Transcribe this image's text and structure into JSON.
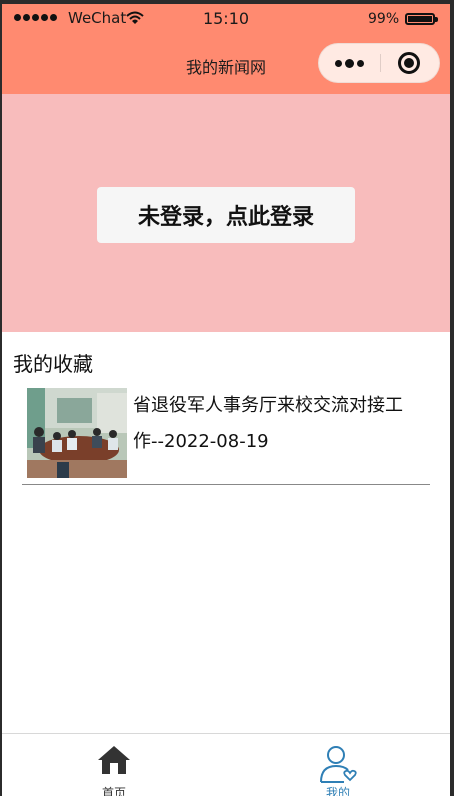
{
  "status_bar": {
    "carrier": "WeChat",
    "time": "15:10",
    "battery_percent": "99%"
  },
  "navbar": {
    "title": "我的新闻网"
  },
  "banner": {
    "login_label": "未登录，点此登录"
  },
  "favorites": {
    "heading": "我的收藏",
    "items": [
      {
        "title": "省退役军人事务厅来校交流对接工作--2022-08-19"
      }
    ]
  },
  "tabbar": {
    "tabs": [
      {
        "label": "首页",
        "icon": "home-icon"
      },
      {
        "label": "我的",
        "icon": "user-icon"
      }
    ],
    "active_color": "#2f7fb5"
  },
  "colors": {
    "header": "#ff8a70",
    "banner": "#f8bcbc",
    "login_button": "#f6f6f6"
  }
}
